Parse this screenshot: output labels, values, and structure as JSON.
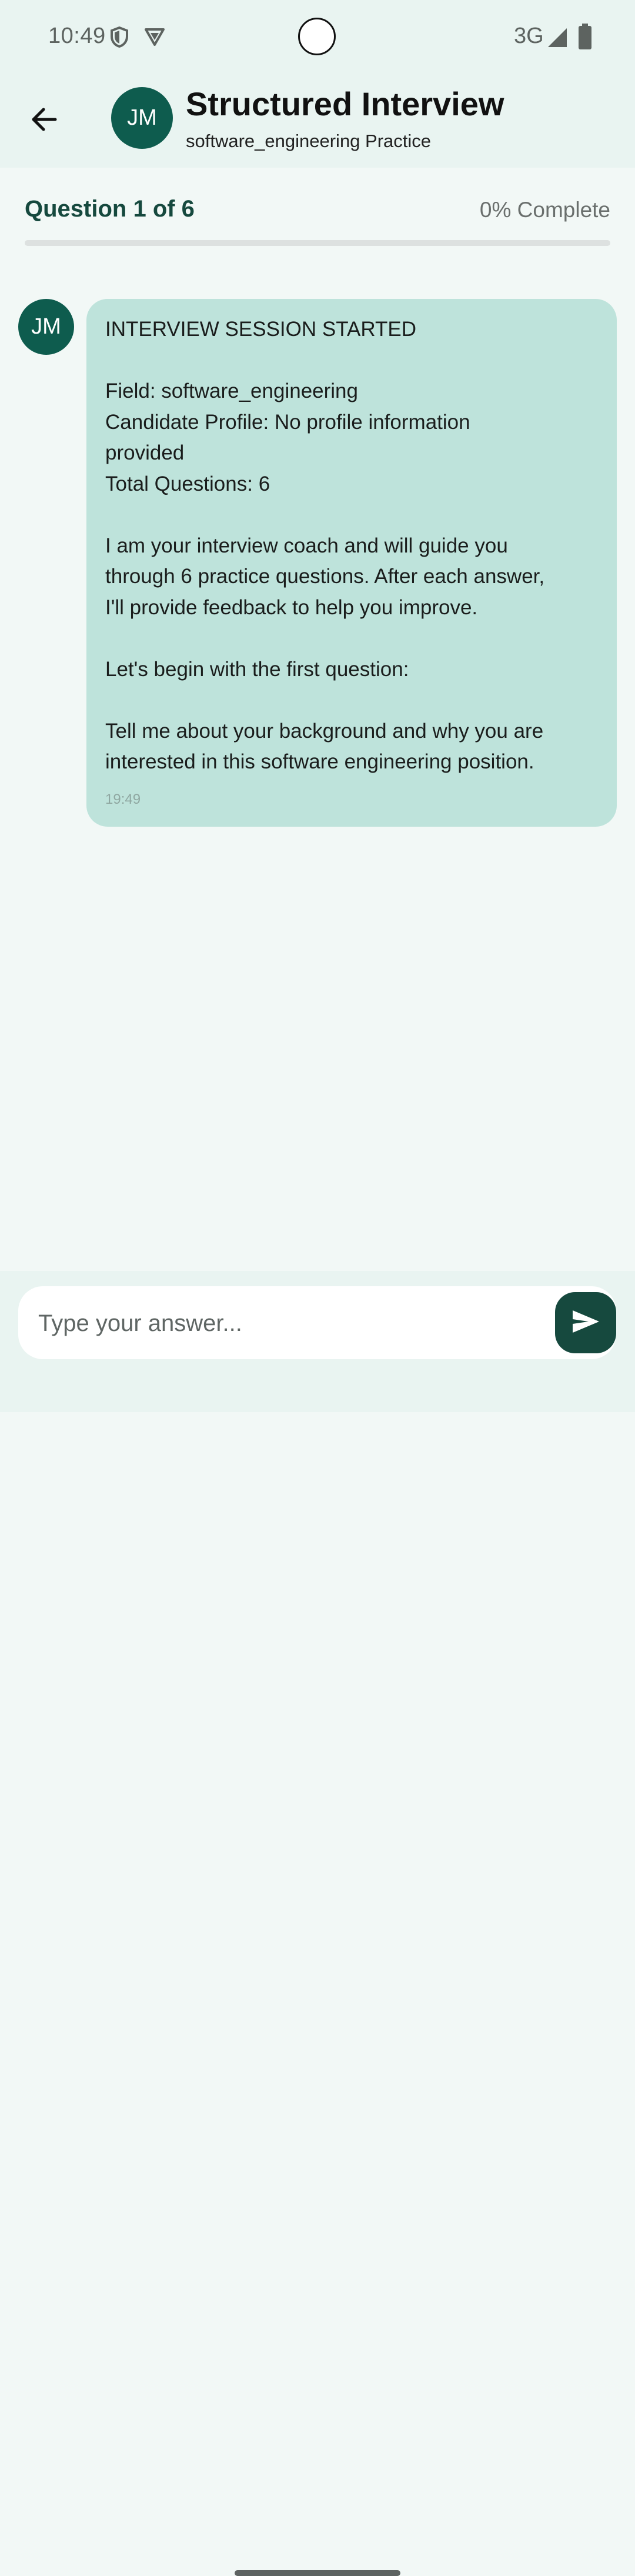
{
  "status_bar": {
    "time": "10:49",
    "network": "3G",
    "icons": [
      "shield-icon",
      "vpn-icon",
      "signal-icon",
      "battery-icon"
    ]
  },
  "header": {
    "back_icon": "arrow-back-icon",
    "avatar_initials": "JM",
    "title": "Structured Interview",
    "subtitle": "software_engineering Practice"
  },
  "progress": {
    "label": "Question 1 of 6",
    "percent_text": "0% Complete",
    "value": 0
  },
  "conversation": {
    "messages": [
      {
        "avatar_initials": "JM",
        "lines": [
          "INTERVIEW SESSION STARTED",
          "",
          "Field: software_engineering",
          "Candidate Profile: No profile information",
          "provided",
          "Total Questions: 6",
          "",
          "I am your interview coach and will guide you",
          "through 6 practice questions. After each answer,",
          "I'll provide feedback to help you improve.",
          "",
          "Let's begin with the first question:",
          "",
          "Tell me about your background and why you are",
          "interested in this software engineering position."
        ],
        "time": "19:49"
      }
    ]
  },
  "input": {
    "placeholder": "Type your answer...",
    "value": "",
    "send_icon": "send-icon"
  },
  "colors": {
    "primary": "#0E5C4E",
    "primary_dark": "#16493E",
    "bubble": "#BEE3DB",
    "header_bg": "#E9F4F1",
    "page_bg": "#F2F8F6"
  }
}
